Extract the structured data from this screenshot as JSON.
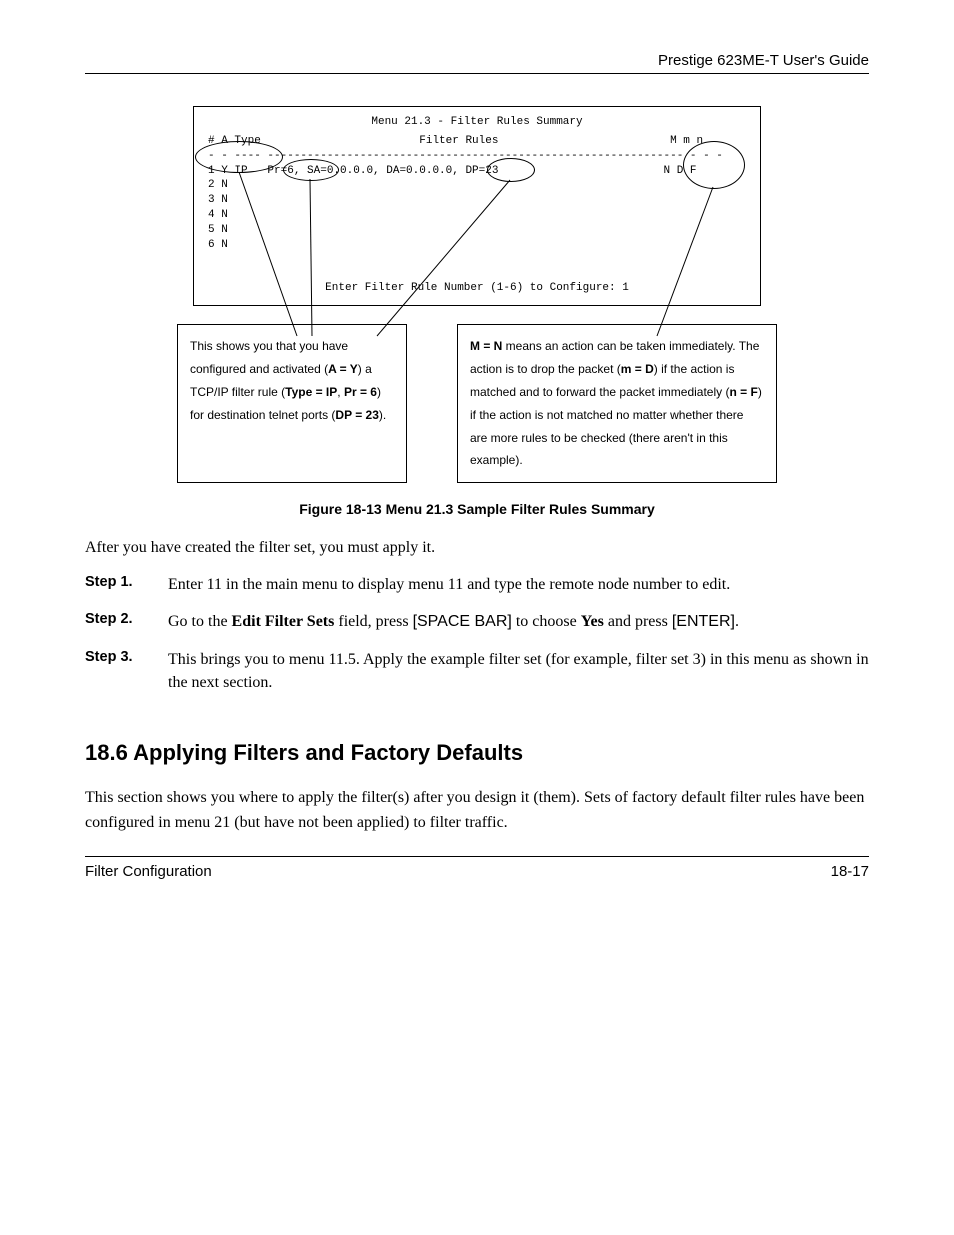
{
  "header": {
    "guide_title": "Prestige 623ME-T User's Guide"
  },
  "terminal": {
    "title": "Menu 21.3 - Filter Rules Summary",
    "header_left": "# A Type",
    "header_mid": "Filter Rules",
    "header_right": "M m n",
    "divider_left": "- - ----",
    "divider_mid": "---------------------------------------------------------------",
    "divider_right": "- - -",
    "rule1_left": "1 Y IP",
    "rule1_mid": "Pr=6, SA=0.0.0.0, DA=0.0.0.0, DP=23",
    "rule1_right": "N D F",
    "row2": "2 N",
    "row3": "3 N",
    "row4": "4 N",
    "row5": "5 N",
    "row6": "6 N",
    "prompt": "Enter Filter Rule Number (1-6) to Configure: 1"
  },
  "callouts": {
    "left_p1": "This shows you that you have configured and activated (",
    "left_b1": "A = Y",
    "left_p2": ") a TCP/IP filter rule (",
    "left_b2": "Type = IP",
    "left_sep": ", ",
    "left_b3": "Pr = 6",
    "left_p3": ") for destination telnet ports (",
    "left_b4": "DP = 23",
    "left_p4": ").",
    "right_b1": "M = N",
    "right_p1": " means an action can be taken immediately. The action is to drop the packet (",
    "right_b2": "m = D",
    "right_p2": ") if the action is matched and to forward the packet immediately (",
    "right_b3": "n = F",
    "right_p3": ") if the action is not matched no matter whether there are more rules to be checked (there aren't in this example)."
  },
  "figure_caption": "Figure 18-13 Menu 21.3 Sample Filter Rules Summary",
  "body": {
    "intro": "After you have created the filter set, you must apply it.",
    "step1_label": "Step 1.",
    "step1_text": "Enter 11 in the main menu to display menu 11 and type the remote node number to edit.",
    "step2_label": "Step 2.",
    "step2_a": "Go to the ",
    "step2_b": "Edit Filter Sets",
    "step2_c": " field, press ",
    "step2_d": "[SPACE BAR]",
    "step2_e": " to choose ",
    "step2_f": "Yes",
    "step2_g": " and press ",
    "step2_h": "[ENTER]",
    "step2_i": ".",
    "step3_label": "Step 3.",
    "step3_text": "This brings you to menu 11.5. Apply the example filter set  (for example, filter set 3) in this menu as shown in the next section."
  },
  "section": {
    "heading": "18.6  Applying Filters and Factory Defaults",
    "para": "This section shows you where to apply the filter(s) after you design it (them). Sets of factory default filter rules have been configured in menu 21 (but have not been applied) to filter traffic."
  },
  "footer": {
    "left": "Filter Configuration",
    "right": "18-17"
  }
}
